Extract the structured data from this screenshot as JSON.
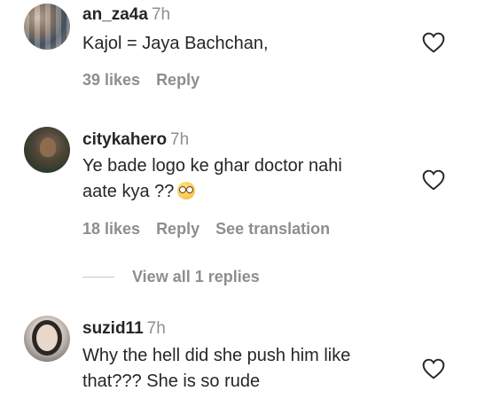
{
  "comments": [
    {
      "username": "an_za4a",
      "time": "7h",
      "lines": [
        "Kajol = Jaya Bachchan,"
      ],
      "likes": "39 likes",
      "reply": "Reply"
    },
    {
      "username": "citykahero",
      "time": "7h",
      "lines": [
        "Ye bade logo ke ghar doctor nahi",
        "aate kya ??"
      ],
      "emoji": "flushed-face-emoji",
      "likes": "18 likes",
      "reply": "Reply",
      "translate": "See translation"
    },
    {
      "username": "suzid11",
      "time": "7h",
      "lines": [
        "Why the hell did she push him like",
        "that??? She is so rude"
      ]
    }
  ],
  "view_replies": "View all 1 replies",
  "icons": {
    "like": "heart-outline-icon"
  },
  "colors": {
    "text": "#262626",
    "muted": "#8e8e8e",
    "background": "#ffffff"
  }
}
